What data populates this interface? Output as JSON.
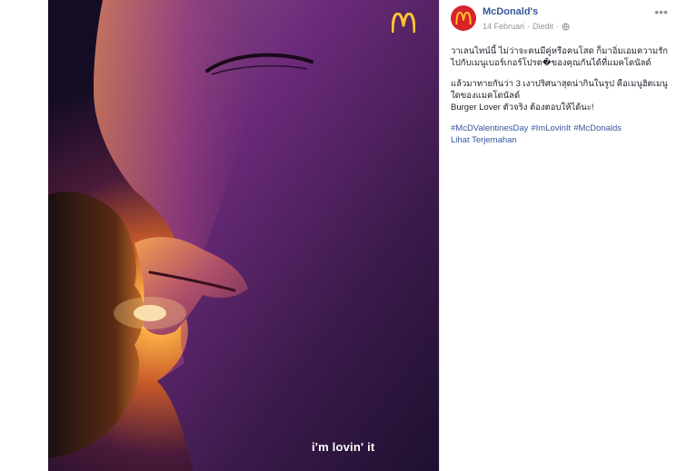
{
  "ad_image": {
    "tagline": "i'm lovin' it",
    "logo_icon": "mcdonalds-golden-arches-icon",
    "colors": {
      "background_dark": "#140c22",
      "glow": "#ffb347",
      "purple": "#6b2a7a",
      "logo_yellow": "#ffc72c"
    }
  },
  "post": {
    "page_name": "McDonald's",
    "date": "14 Februari",
    "separator": "·",
    "edited_label": "Diedit",
    "privacy_icon": "globe-icon",
    "more_icon": "more-options-icon",
    "paragraphs": [
      "วาเลนไทน์นี้ ไม่ว่าจะคนมีคู่หรือคนโสด ก็มาอิ่มเอมความรักไปกับเมนูเบอร์เกอร์โปรด�ของคุณกันได้ที่แมคโดนัลด์",
      "แล้วมาทายกันว่า 3 เงาปริศนาสุดน่ากินในรูป คือเมนูฮิตเมนูใดของแมคโดนัลด์",
      "Burger Lover ตัวจริง ต้องตอบให้ได้นะ!"
    ],
    "hashtags": [
      "#McDValentinesDay",
      "#ImLovinIt",
      "#McDonalds"
    ],
    "translate_link": "Lihat Terjemahan"
  }
}
